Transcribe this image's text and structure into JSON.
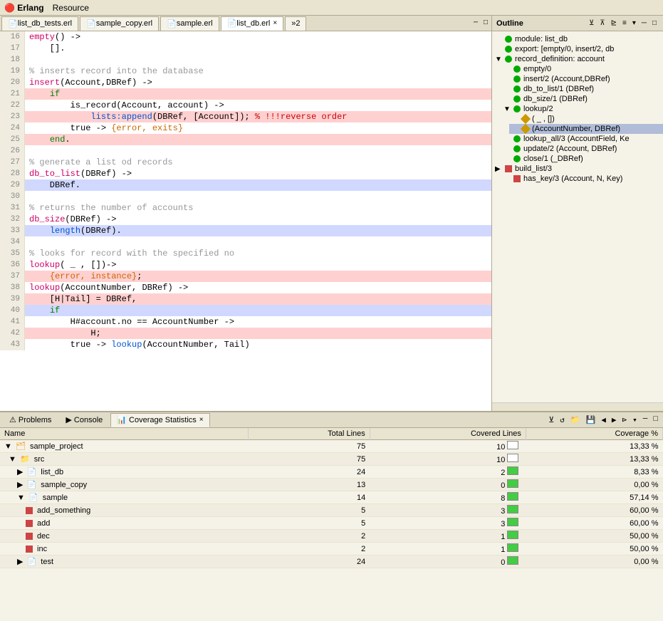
{
  "topbar": {
    "logo": "Erlang",
    "resource": "Resource"
  },
  "tabs": [
    {
      "label": "list_db_tests.erl",
      "active": false
    },
    {
      "label": "sample_copy.erl",
      "active": false
    },
    {
      "label": "sample.erl",
      "active": false
    },
    {
      "label": "list_db.erl",
      "active": true
    },
    {
      "label": "»2",
      "active": false
    }
  ],
  "outline": {
    "title": "Outline",
    "items": [
      {
        "indent": 0,
        "type": "dot-green",
        "expand": "none",
        "label": "module: list_db"
      },
      {
        "indent": 0,
        "type": "dot-green",
        "expand": "none",
        "label": "export: [empty/0, insert/2, db"
      },
      {
        "indent": 0,
        "type": "dot-green",
        "expand": "collapse",
        "label": "record_definition: account"
      },
      {
        "indent": 1,
        "type": "dot-green",
        "expand": "none",
        "label": "empty/0"
      },
      {
        "indent": 1,
        "type": "dot-green",
        "expand": "none",
        "label": "insert/2 (Account,DBRef)"
      },
      {
        "indent": 1,
        "type": "dot-green",
        "expand": "none",
        "label": "db_to_list/1 (DBRef)"
      },
      {
        "indent": 1,
        "type": "dot-green",
        "expand": "none",
        "label": "db_size/1 (DBRef)"
      },
      {
        "indent": 1,
        "type": "dot-green",
        "expand": "expand",
        "label": "lookup/2"
      },
      {
        "indent": 2,
        "type": "diamond",
        "expand": "none",
        "label": "(_, [])"
      },
      {
        "indent": 2,
        "type": "diamond-selected",
        "expand": "none",
        "label": "(AccountNumber, DBRef)"
      },
      {
        "indent": 1,
        "type": "dot-green",
        "expand": "none",
        "label": "lookup_all/3 (AccountField, Ke"
      },
      {
        "indent": 1,
        "type": "dot-green",
        "expand": "none",
        "label": "update/2 (Account, DBRef)"
      },
      {
        "indent": 1,
        "type": "dot-green",
        "expand": "none",
        "label": "close/1 (_DBRef)"
      },
      {
        "indent": 0,
        "type": "dot-red",
        "expand": "expand",
        "label": "build_list/3"
      },
      {
        "indent": 1,
        "type": "dot-red",
        "expand": "none",
        "label": "has_key/3 (Account, N, Key)"
      }
    ]
  },
  "bottomTabs": [
    {
      "label": "Problems",
      "active": false
    },
    {
      "label": "Console",
      "active": false
    },
    {
      "label": "Coverage Statistics",
      "active": true
    }
  ],
  "coverageTable": {
    "headers": [
      "Name",
      "Total Lines",
      "Covered Lines",
      "Coverage %"
    ],
    "rows": [
      {
        "indent": 0,
        "type": "project",
        "expand": "collapse",
        "name": "sample_project",
        "totalLines": "75",
        "coveredLines": "10",
        "covBar": "partial",
        "coverage": "13,33 %"
      },
      {
        "indent": 1,
        "type": "folder",
        "expand": "collapse",
        "name": "src",
        "totalLines": "75",
        "coveredLines": "10",
        "covBar": "partial",
        "coverage": "13,33 %"
      },
      {
        "indent": 2,
        "type": "file",
        "expand": "expand",
        "name": "list_db",
        "totalLines": "24",
        "coveredLines": "2",
        "covBar": "partial",
        "coverage": "8,33 %"
      },
      {
        "indent": 2,
        "type": "file",
        "expand": "expand",
        "name": "sample_copy",
        "totalLines": "13",
        "coveredLines": "0",
        "covBar": "empty",
        "coverage": "0,00 %"
      },
      {
        "indent": 2,
        "type": "file",
        "expand": "collapse",
        "name": "sample",
        "totalLines": "14",
        "coveredLines": "8",
        "covBar": "full",
        "coverage": "57,14 %"
      },
      {
        "indent": 3,
        "type": "fn",
        "expand": "none",
        "name": "add_something",
        "totalLines": "5",
        "coveredLines": "3",
        "covBar": "partial",
        "coverage": "60,00 %"
      },
      {
        "indent": 3,
        "type": "fn",
        "expand": "none",
        "name": "add",
        "totalLines": "5",
        "coveredLines": "3",
        "covBar": "partial",
        "coverage": "60,00 %"
      },
      {
        "indent": 3,
        "type": "fn",
        "expand": "none",
        "name": "dec",
        "totalLines": "2",
        "coveredLines": "1",
        "covBar": "partial",
        "coverage": "50,00 %"
      },
      {
        "indent": 3,
        "type": "fn",
        "expand": "none",
        "name": "inc",
        "totalLines": "2",
        "coveredLines": "1",
        "covBar": "partial",
        "coverage": "50,00 %"
      },
      {
        "indent": 2,
        "type": "file",
        "expand": "expand",
        "name": "test",
        "totalLines": "24",
        "coveredLines": "0",
        "covBar": "empty",
        "coverage": "0,00 %"
      }
    ]
  }
}
